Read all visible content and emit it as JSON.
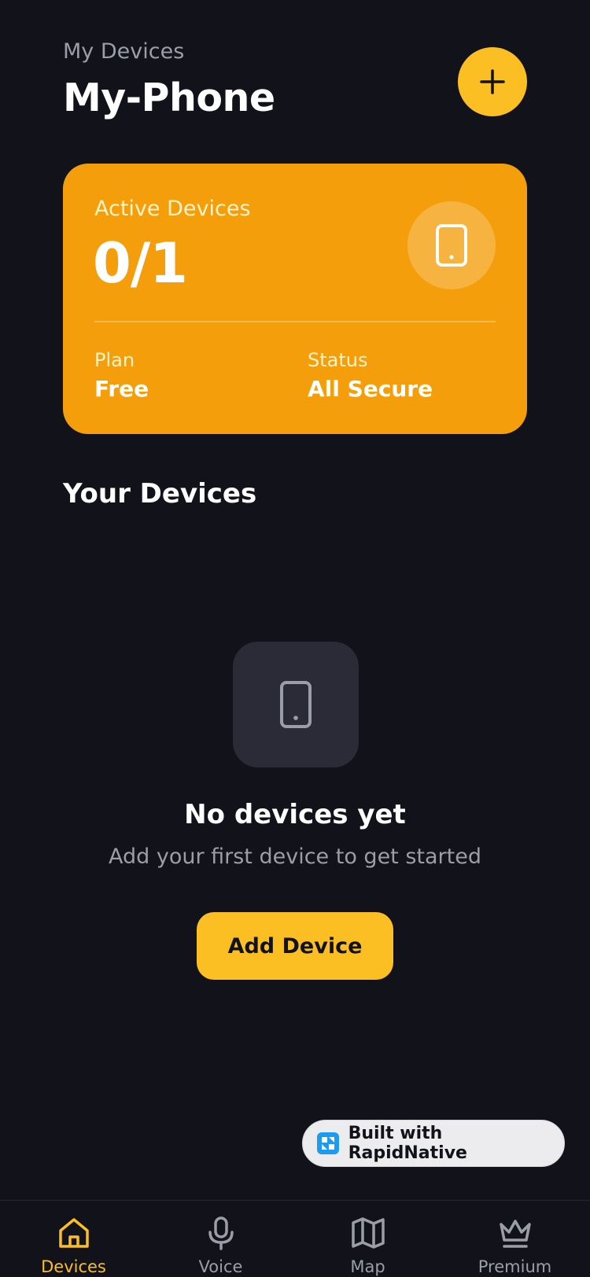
{
  "header": {
    "eyebrow": "My Devices",
    "title": "My-Phone",
    "add_icon": "plus-icon"
  },
  "summary_card": {
    "active_label": "Active Devices",
    "active_count": "0/1",
    "device_icon": "phone-icon",
    "plan_label": "Plan",
    "plan_value": "Free",
    "status_label": "Status",
    "status_value": "All Secure"
  },
  "devices_section": {
    "title": "Your Devices",
    "empty_icon": "phone-icon",
    "empty_title": "No devices yet",
    "empty_subtitle": "Add your first device to get started",
    "add_button_label": "Add Device"
  },
  "badge": {
    "logo_icon": "rapidnative-logo-icon",
    "label": "Built with RapidNative"
  },
  "bottom_nav": {
    "items": [
      {
        "label": "Devices",
        "icon": "home-icon",
        "active": true
      },
      {
        "label": "Voice",
        "icon": "microphone-icon",
        "active": false
      },
      {
        "label": "Map",
        "icon": "map-icon",
        "active": false
      },
      {
        "label": "Premium",
        "icon": "crown-icon",
        "active": false
      }
    ]
  },
  "colors": {
    "background": "#12131a",
    "accent": "#fbbf24",
    "card": "#f59e0b",
    "muted_text": "#9b9ea8",
    "icon_box": "#2a2b36"
  }
}
